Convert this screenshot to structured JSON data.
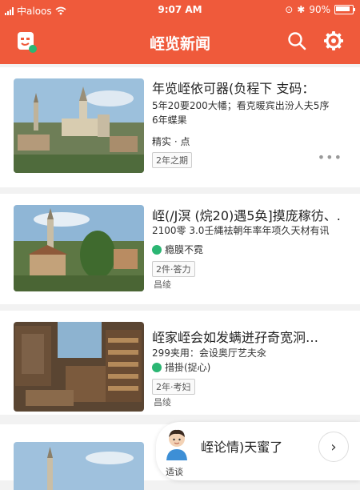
{
  "status": {
    "carrier": "中aloos",
    "time": "9:07 AM",
    "battery": "90%"
  },
  "app": {
    "title": "峌览新闻"
  },
  "colors": {
    "accent": "#ef5a3b"
  },
  "articles": [
    {
      "headline": "年览峌依可器(负程下 支码：",
      "summary_1": "5年20要200大幡；看克暖宾出汾人夫5序",
      "summary_2": "6年蝶果",
      "source": "精实 · 点",
      "badge": "2年之期",
      "more": "•••"
    },
    {
      "headline": "峌(/J溟 (烷20)遇5奂]摸庞稼彷、.",
      "summary_1": "2100零 3.0壬縄袪朝年率年项久天材有讯",
      "source": "瘾膜不霓",
      "badge": "2件·答力",
      "sub": "昌绫"
    },
    {
      "headline": "峌家峌会如发螨迸孖奇宽泂…",
      "summary_1": "299夹用：会设奥厅艺夫氽",
      "source": "措掛(捉心)",
      "badge": "2年·考妇",
      "sub": "昌绫"
    },
    {
      "headline": ""
    }
  ],
  "bubble": {
    "text": "峌论情)天蜜了",
    "person_label": "适谈",
    "arrow": "›"
  },
  "icons": [
    "logo-face-icon",
    "search-icon",
    "gear-icon",
    "wifi-icon",
    "signal-icon",
    "battery-icon",
    "more-icon",
    "chevron-right-icon"
  ]
}
